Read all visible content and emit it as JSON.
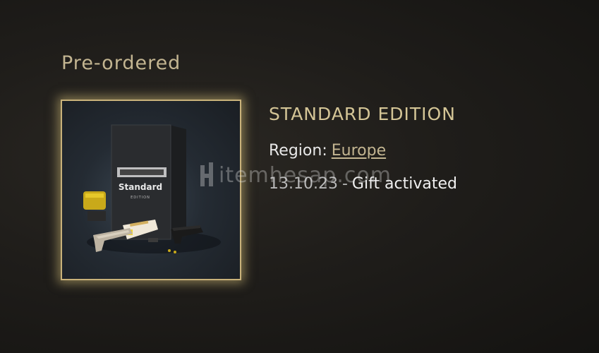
{
  "section": {
    "title": "Pre-ordered"
  },
  "product": {
    "edition_title": "STANDARD EDITION",
    "box_art_text": "Standard",
    "box_art_subtext": "EDITION",
    "region_label": "Region:",
    "region_value": "Europe",
    "activation_date": "13.10.23",
    "separator": "-",
    "activation_status": "Gift activated"
  },
  "watermark": {
    "text": "itemhesap.com"
  },
  "colors": {
    "accent_gold": "#c3b591",
    "card_border": "#c9b27a",
    "background": "#1f1d1a"
  }
}
